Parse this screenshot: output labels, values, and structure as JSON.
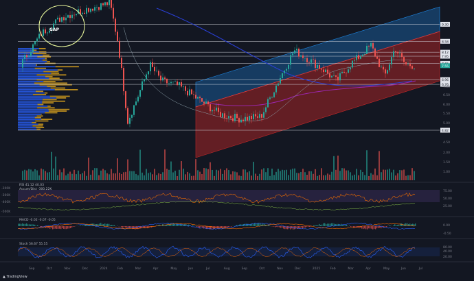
{
  "header": {
    "publisher_line": "saveypigment published on TradingView.com, May 21, 2025 13:20 UTC+2"
  },
  "legend": {
    "symbol_line": "IONQ | NASDAQ | 1D  O7.48 H7.65 L7.36 C7.48 (+0.78%)",
    "lines": [
      "VWAP  7.7084",
      "Vol  1.151M  1.27M",
      "SMA  9.15  9.49",
      "SMA",
      "SMA"
    ]
  },
  "currency": "CNY",
  "annotation": {
    "gap_label": "GAP"
  },
  "price_levels": [
    {
      "label": "9.30",
      "price": 9.3
    },
    {
      "label": "8.58",
      "price": 8.58
    },
    {
      "label": "8.12",
      "price": 8.12
    },
    {
      "label": "7.95",
      "price": 7.95
    },
    {
      "label": "7.65",
      "price": 7.65
    },
    {
      "label": "6.96",
      "price": 6.96
    },
    {
      "label": "6.76",
      "price": 6.76
    },
    {
      "label": "4.82",
      "price": 4.82
    }
  ],
  "current_price": {
    "label": "7.55",
    "price": 7.55
  },
  "price_axis_ticks": [
    "7.00",
    "6.50",
    "6.00",
    "5.50",
    "5.00",
    "4.50",
    "1.00",
    "1.50",
    "2.00"
  ],
  "x_axis_ticks": [
    "Sep",
    "Oct",
    "Nov",
    "Dec",
    "2024",
    "Feb",
    "Mar",
    "Apr",
    "May",
    "Jun",
    "Jul",
    "Aug",
    "Sep",
    "Oct",
    "Nov",
    "Dec",
    "2025",
    "Feb",
    "Mar",
    "Apr",
    "May",
    "Jun",
    "Jul"
  ],
  "panes": {
    "rsi": {
      "title": "RSI  41.12  40.03",
      "subtitle": "Accum/Dist  -300.22K",
      "ticks": [
        "75.00",
        "50.00",
        "25.00"
      ],
      "left_ticks": [
        "-200K",
        "-300K",
        "-400K",
        "-500K"
      ]
    },
    "macd": {
      "title": "MACD  -0.02  -0.07  -0.05",
      "ticks": [
        "0.00",
        "-0.50"
      ]
    },
    "stoch": {
      "title": "Stoch  56.67  55.55",
      "ticks": [
        "80.00",
        "40.00",
        "20.00"
      ]
    }
  },
  "branding": "TradingView",
  "colors": {
    "bg": "#131722",
    "up": "#26a69a",
    "down": "#ef5350",
    "channel_upper": "#1e88e5",
    "channel_lower": "#c62828",
    "ma_purple": "#7e57c2",
    "volume_profile_blue": "#2962ff",
    "volume_profile_gold": "#d6a01d"
  }
}
